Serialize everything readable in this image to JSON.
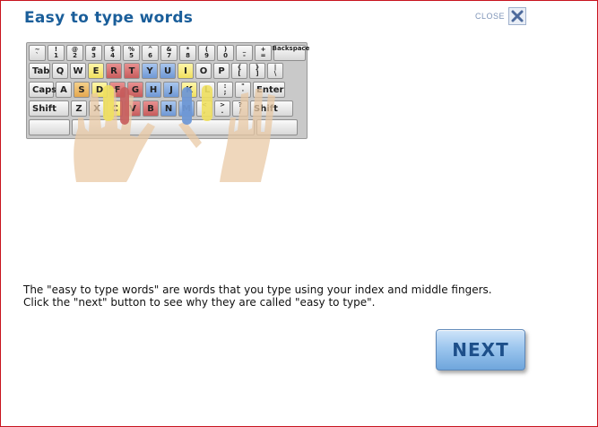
{
  "title": "Easy to type words",
  "close": {
    "label": "CLOSE",
    "icon": "close-x-icon"
  },
  "keyboard": {
    "row1": [
      {
        "t": "~",
        "b": "`"
      },
      {
        "t": "!",
        "b": "1"
      },
      {
        "t": "@",
        "b": "2"
      },
      {
        "t": "#",
        "b": "3"
      },
      {
        "t": "$",
        "b": "4"
      },
      {
        "t": "%",
        "b": "5"
      },
      {
        "t": "^",
        "b": "6"
      },
      {
        "t": "&",
        "b": "7"
      },
      {
        "t": "*",
        "b": "8"
      },
      {
        "t": "(",
        "b": "9"
      },
      {
        "t": ")",
        "b": "0"
      },
      {
        "t": "_",
        "b": "-"
      },
      {
        "t": "+",
        "b": "="
      }
    ],
    "backspace": "Backspace",
    "tab": "Tab",
    "row2": [
      "Q",
      "W",
      "E",
      "R",
      "T",
      "Y",
      "U",
      "I",
      "O",
      "P"
    ],
    "row2_punct": [
      {
        "t": "{",
        "b": "["
      },
      {
        "t": "}",
        "b": "]"
      },
      {
        "t": "|",
        "b": "\\"
      }
    ],
    "caps": "Caps",
    "row3": [
      "A",
      "S",
      "D",
      "F",
      "G",
      "H",
      "J",
      "K",
      "L"
    ],
    "row3_punct": [
      {
        "t": ":",
        "b": ";"
      },
      {
        "t": "\"",
        "b": "'"
      }
    ],
    "enter": "Enter",
    "shift_left": "Shift",
    "row4": [
      "Z",
      "X",
      "C",
      "V",
      "B",
      "N",
      "M"
    ],
    "row4_punct": [
      {
        "t": "<",
        "b": ","
      },
      {
        "t": ">",
        "b": "."
      },
      {
        "t": "?",
        "b": "/"
      }
    ],
    "shift_right": "Shift",
    "colors": {
      "yellow": "#f0e060",
      "orange": "#e5a850",
      "red": "#c65c5c",
      "blue": "#6f98d5"
    }
  },
  "body_text": {
    "line1": "The \"easy to type words\" are words that you type using your index and middle fingers.",
    "line2": "Click the \"next\" button to see why they are called \"easy to type\"."
  },
  "next_label": "NEXT"
}
